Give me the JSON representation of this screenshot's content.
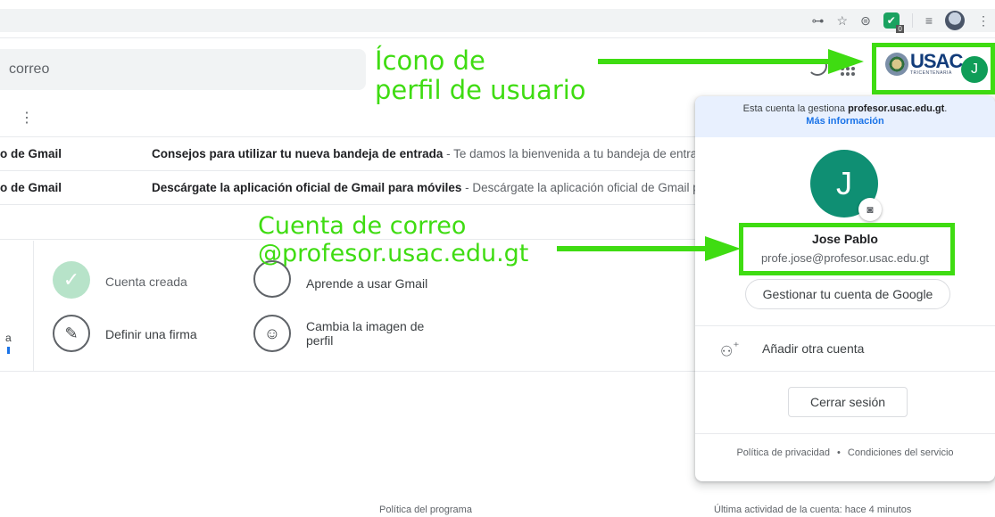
{
  "chrome": {
    "icons": [
      "key-icon",
      "star-icon",
      "extension-icon",
      "grammarly-extension-icon",
      "reading-list-icon",
      "profile-avatar-icon",
      "menu-kebab-icon"
    ],
    "extension_badge": "0",
    "key_glyph": "⊶",
    "star_glyph": "☆",
    "ext_glyph": "⊜",
    "ext_check": "✔",
    "list_glyph": "≡",
    "menu_glyph": "⋮"
  },
  "gmail": {
    "search_placeholder": "correo",
    "more_glyph": "⋮",
    "emails": [
      {
        "sender": "o de Gmail",
        "subject": "Consejos para utilizar tu nueva bandeja de entrada",
        "snippet": " - Te damos la bienvenida a tu bandeja de entrada"
      },
      {
        "sender": "o de Gmail",
        "subject": "Descárgate la aplicación oficial de Gmail para móviles",
        "snippet": " - Descárgate la aplicación oficial de Gmail pa"
      }
    ],
    "getting_started": {
      "account_created": "Cuenta creada",
      "learn_gmail": "Aprende a usar Gmail",
      "define_signature": "Definir una firma",
      "change_image": "Cambia la imagen de perfil",
      "check_glyph": "✓",
      "pencil_glyph": "✎",
      "person_glyph": "☺",
      "left_fragment": "a"
    },
    "footer_left": "Política del programa",
    "footer_right": "Última actividad de la cuenta: hace 4 minutos"
  },
  "profile": {
    "logo_text": "USAC",
    "logo_subtext": "TRICENTENARIA",
    "avatar_initial": "J"
  },
  "account_panel": {
    "managed_prefix": "Esta cuenta la gestiona ",
    "managed_domain": "profesor.usac.edu.gt",
    "managed_suffix": ".",
    "more_info": "Más información",
    "avatar_initial": "J",
    "camera_glyph": "◙",
    "name": "Jose Pablo",
    "email": "profe.jose@profesor.usac.edu.gt",
    "manage_button": "Gestionar tu cuenta de Google",
    "add_account_glyph": "⁺",
    "add_account": "Añadir otra cuenta",
    "sign_out": "Cerrar sesión",
    "privacy": "Política de privacidad",
    "dot": "•",
    "terms": "Condiciones del servicio"
  },
  "annotations": {
    "profile_line1": "Ícono de",
    "profile_line2": "perfil de usuario",
    "account_line1": "Cuenta de correo",
    "account_line2": "@profesor.usac.edu.gt",
    "color": "#3fdc12"
  }
}
